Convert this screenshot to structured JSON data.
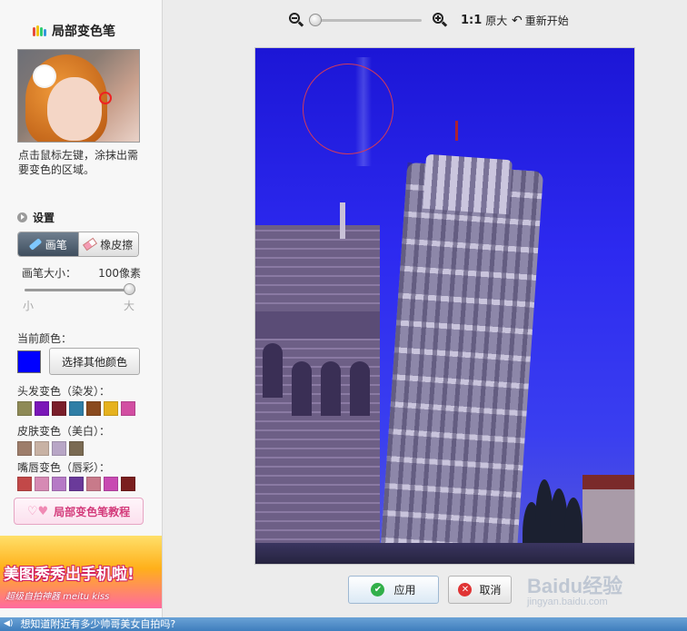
{
  "sidebar": {
    "title": "局部变色笔",
    "hint": "点击鼠标左键，涂抹出需要变色的区域。",
    "settings_label": "设置",
    "brush_label": "画笔",
    "eraser_label": "橡皮擦",
    "brush_size_label": "画笔大小：",
    "brush_size_value": "100像素",
    "size_min": "小",
    "size_max": "大",
    "current_color_label": "当前颜色：",
    "current_color": "#0000ff",
    "choose_other_color": "选择其他颜色",
    "groups": [
      {
        "label": "头发变色（染发）：",
        "colors": [
          "#8e8a56",
          "#7a16b8",
          "#7a1e2a",
          "#2f7ea6",
          "#8a4a1e",
          "#e6b21e",
          "#d24ea2"
        ]
      },
      {
        "label": "皮肤变色（美白）：",
        "colors": [
          "#9d7d6a",
          "#c8b2a4",
          "#b8a6c6",
          "#7a6a52"
        ]
      },
      {
        "label": "嘴唇变色（唇彩）：",
        "colors": [
          "#c24848",
          "#d68ab4",
          "#b67ac6",
          "#6a3a9a",
          "#c87a8a",
          "#c84ab2",
          "#7a1e1e"
        ]
      }
    ],
    "tutorial_label": "局部变色笔教程",
    "ad_main": "美图秀秀出手机啦!",
    "ad_sub": "超级自拍神器 meitu kiss"
  },
  "toolbar": {
    "original_size_prefix": "1:1",
    "original_size_label": "原大",
    "restart_label": "重新开始"
  },
  "actions": {
    "apply_label": "应用",
    "cancel_label": "取消"
  },
  "watermark": {
    "main": "Baidu经验",
    "sub": "jingyan.baidu.com"
  },
  "statusbar": {
    "text": "想知道附近有多少帅哥美女自拍吗?"
  },
  "colors": {
    "accent_blue": "#0000ff",
    "apply_icon": "#32b04a",
    "cancel_icon": "#e03434"
  }
}
